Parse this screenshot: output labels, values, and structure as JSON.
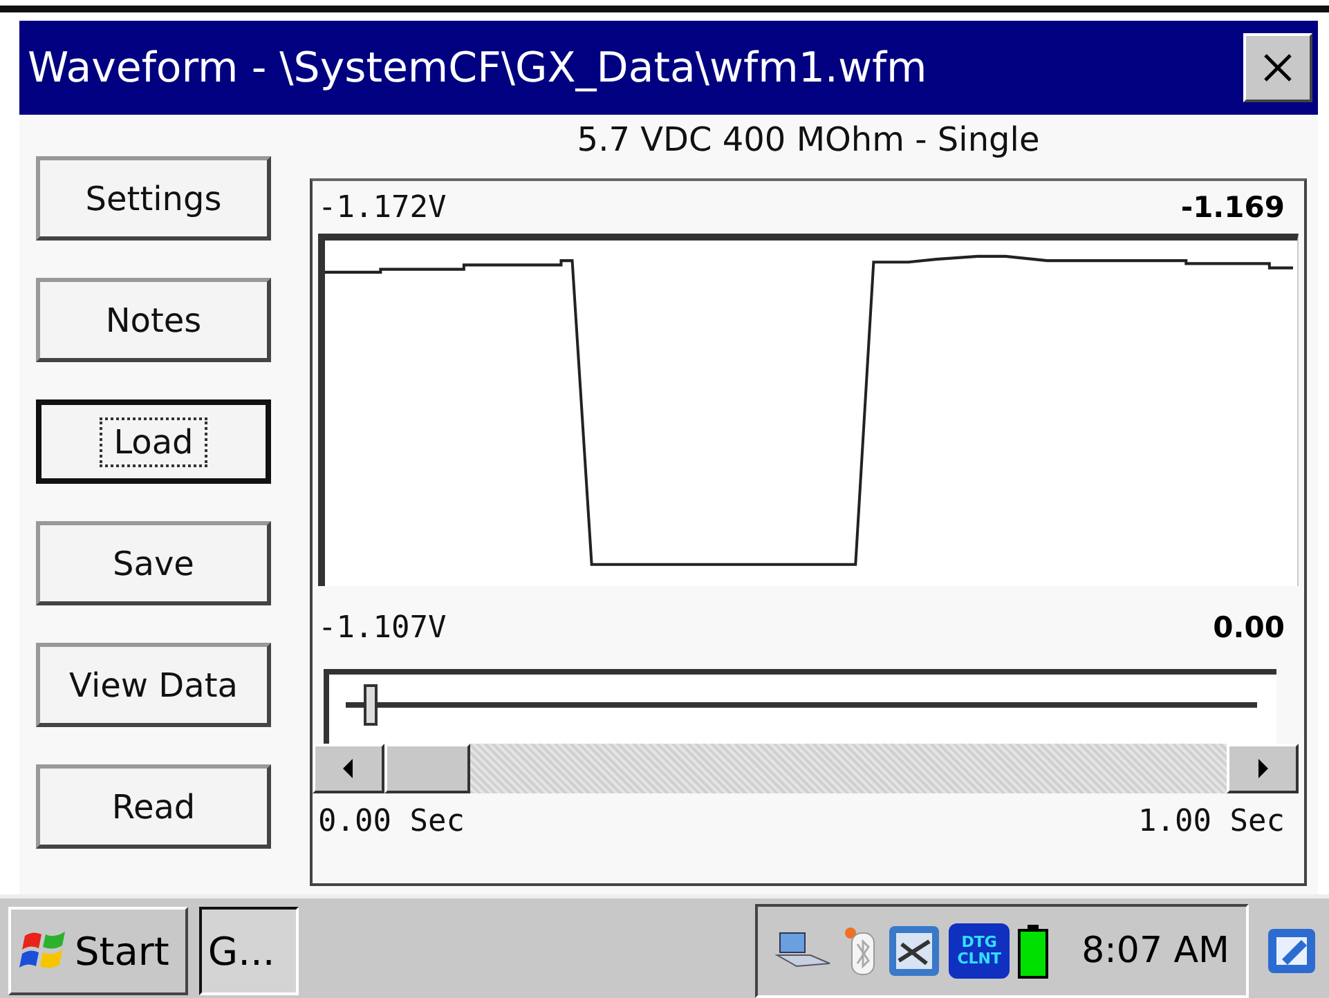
{
  "window": {
    "title": "Waveform - \\SystemCF\\GX_Data\\wfm1.wfm"
  },
  "header": "5.7 VDC 400 MOhm - Single",
  "buttons": [
    {
      "label": "Settings",
      "focused": false
    },
    {
      "label": "Notes",
      "focused": false
    },
    {
      "label": "Load",
      "focused": true
    },
    {
      "label": "Save",
      "focused": false
    },
    {
      "label": "View Data",
      "focused": false
    },
    {
      "label": "Read",
      "focused": false
    }
  ],
  "waveform_panel": {
    "cursor_value": "-1.172V",
    "cursor_reading": "-1.169",
    "position_value": "-1.107V",
    "position_reading": "0.00",
    "slider": {
      "level": 0.02
    },
    "start_label": "0.00 Sec",
    "end_label": "1.00 Sec"
  },
  "taskbar": {
    "start": "Start",
    "tasks": [
      {
        "label": "G...",
        "selected": true
      }
    ],
    "tray_icon_text": [
      "DTG",
      "CLNT"
    ],
    "clock": "8:07 AM"
  }
}
